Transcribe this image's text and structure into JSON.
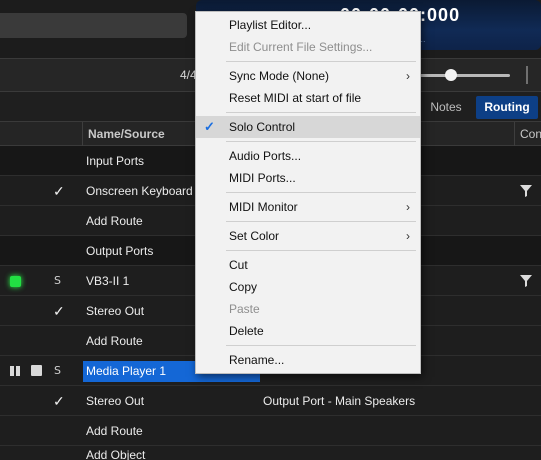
{
  "display": {
    "time": "00:00:00:000",
    "sub": "..."
  },
  "transport": {
    "time_signature": "4/4"
  },
  "tabs": {
    "notes": "Notes",
    "routing": "Routing"
  },
  "columns": {
    "name_source": "Name/Source",
    "connection": "Con"
  },
  "rows": {
    "input_ports": "Input Ports",
    "onscreen_keyboard": "Onscreen Keyboard",
    "add_route_1": "Add Route",
    "output_ports": "Output Ports",
    "vb3": "VB3-II 1",
    "s_label": "S",
    "stereo_out_1": "Stereo Out",
    "add_route_2": "Add Route",
    "media_player": "Media Player 1",
    "stereo_out_2": "Stereo Out",
    "stereo_out_2_conn": "Output Port - Main Speakers",
    "add_route_3": "Add Route",
    "add_object": "Add Object"
  },
  "check_glyph": "✓",
  "menu": {
    "items": [
      {
        "label": "Playlist Editor..."
      },
      {
        "label": "Edit Current File Settings...",
        "disabled": true
      },
      {
        "label": "Sync Mode (None)",
        "submenu": true
      },
      {
        "label": "Reset MIDI at start of file"
      },
      {
        "label": "Solo Control",
        "checked": true
      },
      {
        "label": "Audio Ports..."
      },
      {
        "label": "MIDI Ports..."
      },
      {
        "label": "MIDI Monitor",
        "submenu": true
      },
      {
        "label": "Set Color",
        "submenu": true
      },
      {
        "label": "Cut"
      },
      {
        "label": "Copy"
      },
      {
        "label": "Paste",
        "disabled": true
      },
      {
        "label": "Delete"
      },
      {
        "label": "Rename..."
      }
    ],
    "arrow_glyph": "›"
  },
  "colors": {
    "accent": "#1467d6",
    "routing_tab": "#0d3f86",
    "led": "#22e043"
  }
}
